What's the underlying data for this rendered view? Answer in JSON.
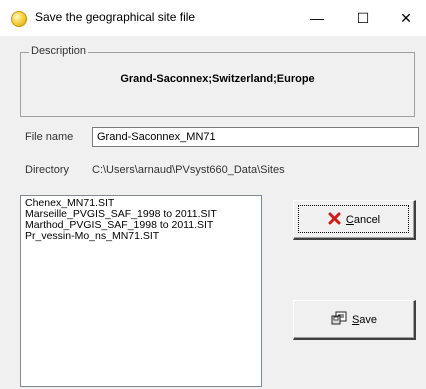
{
  "window": {
    "title": "Save the geographical site file",
    "controls": {
      "minimize": "—",
      "maximize": "☐",
      "close": "✕"
    }
  },
  "description": {
    "legend": "Description",
    "value": "Grand-Saconnex;Switzerland;Europe"
  },
  "file_name": {
    "label": "File name",
    "value": "Grand-Saconnex_MN71"
  },
  "directory": {
    "label": "Directory",
    "value": "C:\\Users\\arnaud\\PVsyst660_Data\\Sites"
  },
  "files": [
    "Chenex_MN71.SIT",
    "Marseille_PVGIS_SAF_1998 to 2011.SIT",
    "Marthod_PVGIS_SAF_1998 to 2011.SIT",
    "Pr_vessin-Mo_ns_MN71.SIT"
  ],
  "buttons": {
    "cancel": {
      "mnemonic": "C",
      "rest": "ancel"
    },
    "save": {
      "mnemonic": "S",
      "rest": "ave"
    }
  },
  "icons": {
    "app": "sun-icon",
    "cancel": "red-x-icon",
    "save": "save-disk-icon"
  },
  "colors": {
    "cancel_x": "#d11a1a"
  }
}
